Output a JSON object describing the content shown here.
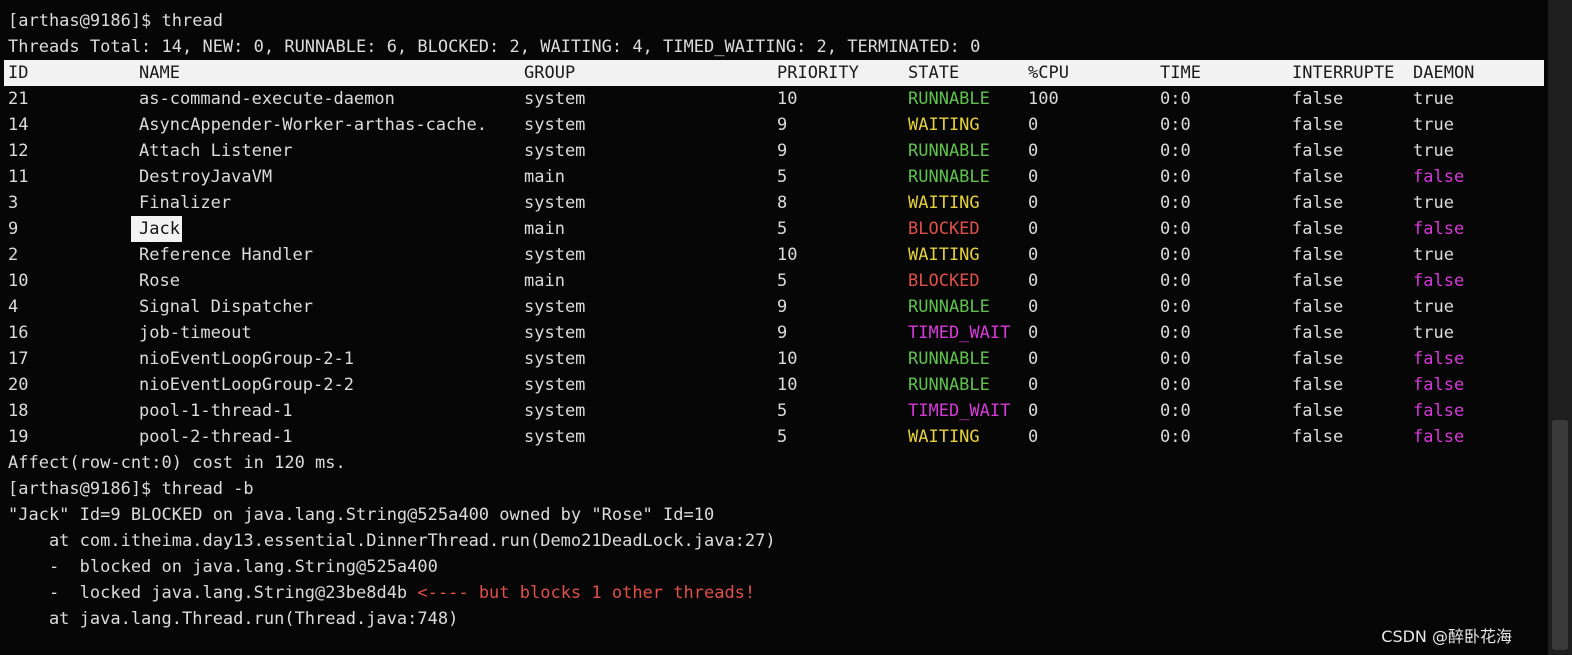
{
  "terminal": {
    "prompt1": "[arthas@9186]$ thread",
    "summary": "Threads Total: 14, NEW: 0, RUNNABLE: 6, BLOCKED: 2, WAITING: 4, TIMED_WAITING: 2, TERMINATED: 0",
    "columns": {
      "id": "ID",
      "name": "NAME",
      "group": "GROUP",
      "priority": "PRIORITY",
      "state": "STATE",
      "cpu": "%CPU",
      "time": "TIME",
      "interrupted": "INTERRUPTE",
      "daemon": "DAEMON"
    },
    "rows": [
      {
        "id": "21",
        "name": "as-command-execute-daemon",
        "group": "system",
        "priority": "10",
        "state": "RUNNABLE",
        "cpu": "100",
        "time": "0:0",
        "interrupted": "false",
        "daemon": "true"
      },
      {
        "id": "14",
        "name": "AsyncAppender-Worker-arthas-cache.",
        "group": "system",
        "priority": "9",
        "state": "WAITING",
        "cpu": "0",
        "time": "0:0",
        "interrupted": "false",
        "daemon": "true"
      },
      {
        "id": "12",
        "name": "Attach Listener",
        "group": "system",
        "priority": "9",
        "state": "RUNNABLE",
        "cpu": "0",
        "time": "0:0",
        "interrupted": "false",
        "daemon": "true"
      },
      {
        "id": "11",
        "name": "DestroyJavaVM",
        "group": "main",
        "priority": "5",
        "state": "RUNNABLE",
        "cpu": "0",
        "time": "0:0",
        "interrupted": "false",
        "daemon": "false"
      },
      {
        "id": "3",
        "name": "Finalizer",
        "group": "system",
        "priority": "8",
        "state": "WAITING",
        "cpu": "0",
        "time": "0:0",
        "interrupted": "false",
        "daemon": "true"
      },
      {
        "id": "9",
        "name": "Jack",
        "group": "main",
        "priority": "5",
        "state": "BLOCKED",
        "cpu": "0",
        "time": "0:0",
        "interrupted": "false",
        "daemon": "false"
      },
      {
        "id": "2",
        "name": "Reference Handler",
        "group": "system",
        "priority": "10",
        "state": "WAITING",
        "cpu": "0",
        "time": "0:0",
        "interrupted": "false",
        "daemon": "true"
      },
      {
        "id": "10",
        "name": "Rose",
        "group": "main",
        "priority": "5",
        "state": "BLOCKED",
        "cpu": "0",
        "time": "0:0",
        "interrupted": "false",
        "daemon": "false"
      },
      {
        "id": "4",
        "name": "Signal Dispatcher",
        "group": "system",
        "priority": "9",
        "state": "RUNNABLE",
        "cpu": "0",
        "time": "0:0",
        "interrupted": "false",
        "daemon": "true"
      },
      {
        "id": "16",
        "name": "job-timeout",
        "group": "system",
        "priority": "9",
        "state": "TIMED_WAIT",
        "cpu": "0",
        "time": "0:0",
        "interrupted": "false",
        "daemon": "true"
      },
      {
        "id": "17",
        "name": "nioEventLoopGroup-2-1",
        "group": "system",
        "priority": "10",
        "state": "RUNNABLE",
        "cpu": "0",
        "time": "0:0",
        "interrupted": "false",
        "daemon": "false"
      },
      {
        "id": "20",
        "name": "nioEventLoopGroup-2-2",
        "group": "system",
        "priority": "10",
        "state": "RUNNABLE",
        "cpu": "0",
        "time": "0:0",
        "interrupted": "false",
        "daemon": "false"
      },
      {
        "id": "18",
        "name": "pool-1-thread-1",
        "group": "system",
        "priority": "5",
        "state": "TIMED_WAIT",
        "cpu": "0",
        "time": "0:0",
        "interrupted": "false",
        "daemon": "false"
      },
      {
        "id": "19",
        "name": "pool-2-thread-1",
        "group": "system",
        "priority": "5",
        "state": "WAITING",
        "cpu": "0",
        "time": "0:0",
        "interrupted": "false",
        "daemon": "false"
      }
    ],
    "affect": "Affect(row-cnt:0) cost in 120 ms.",
    "prompt2": "[arthas@9186]$ thread -b",
    "blocked_header": "\"Jack\" Id=9 BLOCKED on java.lang.String@525a400 owned by \"Rose\" Id=10",
    "trace1": "    at com.itheima.day13.essential.DinnerThread.run(Demo21DeadLock.java:27)",
    "trace2": "    -  blocked on java.lang.String@525a400",
    "trace3_prefix": "    -  locked java.lang.String@23be8d4b ",
    "trace3_suffix": "<---- but blocks 1 other threads!",
    "trace4": "    at java.lang.Thread.run(Thread.java:748)"
  },
  "watermark": "CSDN @醉卧花海",
  "colors": {
    "background": "#060606",
    "runnable": "#5ec24d",
    "waiting": "#e5d13a",
    "blocked": "#e0504a",
    "timed_wait": "#d63ad8",
    "daemon_false": "#d63ad8"
  }
}
